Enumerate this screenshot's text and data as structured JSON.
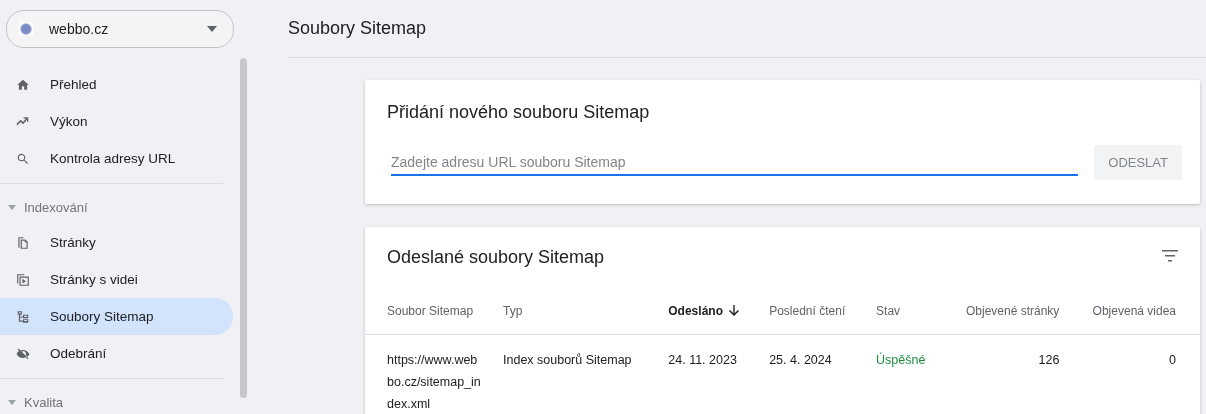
{
  "property_selector": {
    "label": "webbo.cz"
  },
  "sidebar": {
    "items": [
      {
        "kind": "item",
        "label": "Přehled",
        "selected": false
      },
      {
        "kind": "item",
        "label": "Výkon",
        "selected": false
      },
      {
        "kind": "item",
        "label": "Kontrola adresy URL",
        "selected": false
      },
      {
        "kind": "divider"
      },
      {
        "kind": "section",
        "label": "Indexování",
        "expanded": true
      },
      {
        "kind": "item",
        "label": "Stránky",
        "selected": false
      },
      {
        "kind": "item",
        "label": "Stránky s videi",
        "selected": false
      },
      {
        "kind": "item",
        "label": "Soubory Sitemap",
        "selected": true
      },
      {
        "kind": "item",
        "label": "Odebrání",
        "selected": false
      },
      {
        "kind": "divider"
      },
      {
        "kind": "section",
        "label": "Kvalita",
        "expanded": true
      }
    ]
  },
  "page_title": "Soubory Sitemap",
  "add_card": {
    "title": "Přidání nového souboru Sitemap",
    "placeholder": "Zadejte adresu URL souboru Sitemap",
    "button": {
      "label": "ODESLAT",
      "disabled": true
    }
  },
  "submitted_card": {
    "title": "Odeslané soubory Sitemap",
    "table": {
      "columns": [
        {
          "label": "Soubor Sitemap",
          "sorted": false
        },
        {
          "label": "Typ",
          "sorted": false
        },
        {
          "label": "Odesláno",
          "sorted": true
        },
        {
          "label": "Poslední čtení",
          "sorted": false
        },
        {
          "label": "Stav",
          "sorted": false
        },
        {
          "label": "Objevené stránky",
          "sorted": false
        },
        {
          "label": "Objevená videa",
          "sorted": false
        }
      ],
      "rows": [
        {
          "cells": [
            "https://www.webbo.cz/sitemap_index.xml",
            "Index souborů Sitemap",
            "24. 11. 2023",
            "25. 4. 2024",
            "Úspěšné",
            "126",
            "0"
          ]
        }
      ]
    }
  }
}
